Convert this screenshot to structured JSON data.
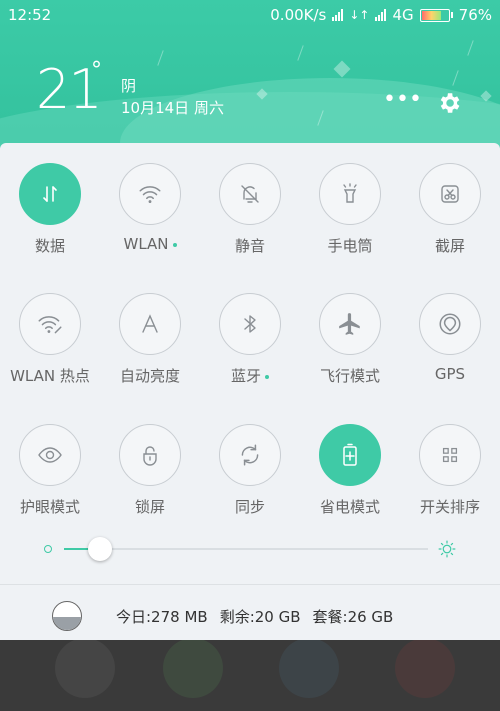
{
  "status_bar": {
    "time": "12:52",
    "net_speed": "0.00K/s",
    "network": "4G",
    "battery": "76%",
    "battery_level": 0.76
  },
  "weather": {
    "temperature": "21",
    "degree": "°",
    "condition": "阴",
    "date": "10月14日 周六"
  },
  "header_actions": {
    "more_icon": "more-icon",
    "settings_icon": "gear-icon"
  },
  "toggles": [
    {
      "label": "数据",
      "icon": "data-icon",
      "on": true
    },
    {
      "label": "WLAN",
      "icon": "wifi-icon",
      "on": false,
      "dot": true
    },
    {
      "label": "静音",
      "icon": "bell-off-icon",
      "on": false
    },
    {
      "label": "手电筒",
      "icon": "flashlight-icon",
      "on": false
    },
    {
      "label": "截屏",
      "icon": "screenshot-icon",
      "on": false
    },
    {
      "label": "WLAN 热点",
      "icon": "hotspot-icon",
      "on": false
    },
    {
      "label": "自动亮度",
      "icon": "auto-brightness-icon",
      "on": false
    },
    {
      "label": "蓝牙",
      "icon": "bluetooth-icon",
      "on": false,
      "dot": true
    },
    {
      "label": "飞行模式",
      "icon": "airplane-icon",
      "on": false
    },
    {
      "label": "GPS",
      "icon": "gps-icon",
      "on": false
    },
    {
      "label": "护眼模式",
      "icon": "eye-icon",
      "on": false
    },
    {
      "label": "锁屏",
      "icon": "lock-icon",
      "on": false
    },
    {
      "label": "同步",
      "icon": "sync-icon",
      "on": false
    },
    {
      "label": "省电模式",
      "icon": "battery-saver-icon",
      "on": true
    },
    {
      "label": "开关排序",
      "icon": "grid-icon",
      "on": false
    }
  ],
  "brightness": {
    "level": 0.1
  },
  "usage": {
    "today": "今日:278 MB",
    "remaining": "剩余:20 GB",
    "plan": "套餐:26 GB"
  },
  "colors": {
    "accent": "#3fcaa6",
    "header": "#3ccba7"
  }
}
